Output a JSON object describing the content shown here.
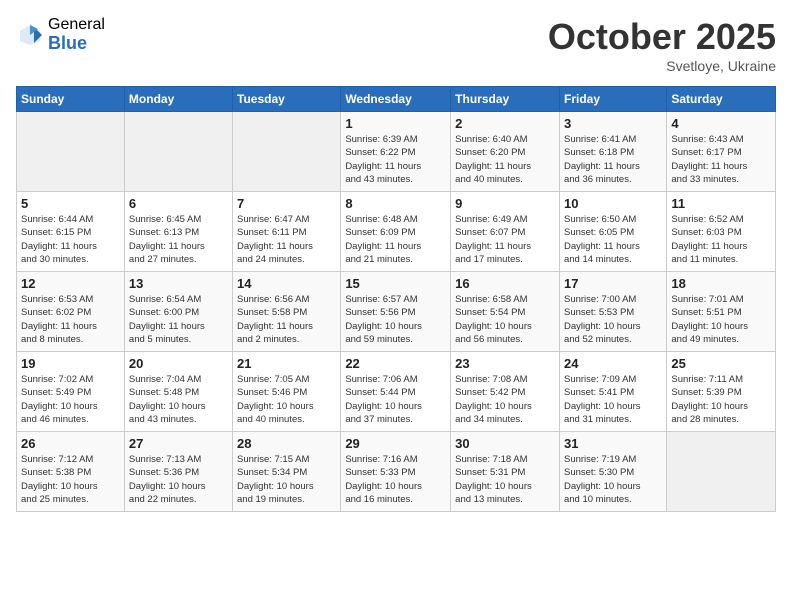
{
  "header": {
    "logo_general": "General",
    "logo_blue": "Blue",
    "month": "October 2025",
    "location": "Svetloye, Ukraine"
  },
  "weekdays": [
    "Sunday",
    "Monday",
    "Tuesday",
    "Wednesday",
    "Thursday",
    "Friday",
    "Saturday"
  ],
  "weeks": [
    [
      {
        "day": "",
        "info": ""
      },
      {
        "day": "",
        "info": ""
      },
      {
        "day": "",
        "info": ""
      },
      {
        "day": "1",
        "info": "Sunrise: 6:39 AM\nSunset: 6:22 PM\nDaylight: 11 hours\nand 43 minutes."
      },
      {
        "day": "2",
        "info": "Sunrise: 6:40 AM\nSunset: 6:20 PM\nDaylight: 11 hours\nand 40 minutes."
      },
      {
        "day": "3",
        "info": "Sunrise: 6:41 AM\nSunset: 6:18 PM\nDaylight: 11 hours\nand 36 minutes."
      },
      {
        "day": "4",
        "info": "Sunrise: 6:43 AM\nSunset: 6:17 PM\nDaylight: 11 hours\nand 33 minutes."
      }
    ],
    [
      {
        "day": "5",
        "info": "Sunrise: 6:44 AM\nSunset: 6:15 PM\nDaylight: 11 hours\nand 30 minutes."
      },
      {
        "day": "6",
        "info": "Sunrise: 6:45 AM\nSunset: 6:13 PM\nDaylight: 11 hours\nand 27 minutes."
      },
      {
        "day": "7",
        "info": "Sunrise: 6:47 AM\nSunset: 6:11 PM\nDaylight: 11 hours\nand 24 minutes."
      },
      {
        "day": "8",
        "info": "Sunrise: 6:48 AM\nSunset: 6:09 PM\nDaylight: 11 hours\nand 21 minutes."
      },
      {
        "day": "9",
        "info": "Sunrise: 6:49 AM\nSunset: 6:07 PM\nDaylight: 11 hours\nand 17 minutes."
      },
      {
        "day": "10",
        "info": "Sunrise: 6:50 AM\nSunset: 6:05 PM\nDaylight: 11 hours\nand 14 minutes."
      },
      {
        "day": "11",
        "info": "Sunrise: 6:52 AM\nSunset: 6:03 PM\nDaylight: 11 hours\nand 11 minutes."
      }
    ],
    [
      {
        "day": "12",
        "info": "Sunrise: 6:53 AM\nSunset: 6:02 PM\nDaylight: 11 hours\nand 8 minutes."
      },
      {
        "day": "13",
        "info": "Sunrise: 6:54 AM\nSunset: 6:00 PM\nDaylight: 11 hours\nand 5 minutes."
      },
      {
        "day": "14",
        "info": "Sunrise: 6:56 AM\nSunset: 5:58 PM\nDaylight: 11 hours\nand 2 minutes."
      },
      {
        "day": "15",
        "info": "Sunrise: 6:57 AM\nSunset: 5:56 PM\nDaylight: 10 hours\nand 59 minutes."
      },
      {
        "day": "16",
        "info": "Sunrise: 6:58 AM\nSunset: 5:54 PM\nDaylight: 10 hours\nand 56 minutes."
      },
      {
        "day": "17",
        "info": "Sunrise: 7:00 AM\nSunset: 5:53 PM\nDaylight: 10 hours\nand 52 minutes."
      },
      {
        "day": "18",
        "info": "Sunrise: 7:01 AM\nSunset: 5:51 PM\nDaylight: 10 hours\nand 49 minutes."
      }
    ],
    [
      {
        "day": "19",
        "info": "Sunrise: 7:02 AM\nSunset: 5:49 PM\nDaylight: 10 hours\nand 46 minutes."
      },
      {
        "day": "20",
        "info": "Sunrise: 7:04 AM\nSunset: 5:48 PM\nDaylight: 10 hours\nand 43 minutes."
      },
      {
        "day": "21",
        "info": "Sunrise: 7:05 AM\nSunset: 5:46 PM\nDaylight: 10 hours\nand 40 minutes."
      },
      {
        "day": "22",
        "info": "Sunrise: 7:06 AM\nSunset: 5:44 PM\nDaylight: 10 hours\nand 37 minutes."
      },
      {
        "day": "23",
        "info": "Sunrise: 7:08 AM\nSunset: 5:42 PM\nDaylight: 10 hours\nand 34 minutes."
      },
      {
        "day": "24",
        "info": "Sunrise: 7:09 AM\nSunset: 5:41 PM\nDaylight: 10 hours\nand 31 minutes."
      },
      {
        "day": "25",
        "info": "Sunrise: 7:11 AM\nSunset: 5:39 PM\nDaylight: 10 hours\nand 28 minutes."
      }
    ],
    [
      {
        "day": "26",
        "info": "Sunrise: 7:12 AM\nSunset: 5:38 PM\nDaylight: 10 hours\nand 25 minutes."
      },
      {
        "day": "27",
        "info": "Sunrise: 7:13 AM\nSunset: 5:36 PM\nDaylight: 10 hours\nand 22 minutes."
      },
      {
        "day": "28",
        "info": "Sunrise: 7:15 AM\nSunset: 5:34 PM\nDaylight: 10 hours\nand 19 minutes."
      },
      {
        "day": "29",
        "info": "Sunrise: 7:16 AM\nSunset: 5:33 PM\nDaylight: 10 hours\nand 16 minutes."
      },
      {
        "day": "30",
        "info": "Sunrise: 7:18 AM\nSunset: 5:31 PM\nDaylight: 10 hours\nand 13 minutes."
      },
      {
        "day": "31",
        "info": "Sunrise: 7:19 AM\nSunset: 5:30 PM\nDaylight: 10 hours\nand 10 minutes."
      },
      {
        "day": "",
        "info": ""
      }
    ]
  ]
}
